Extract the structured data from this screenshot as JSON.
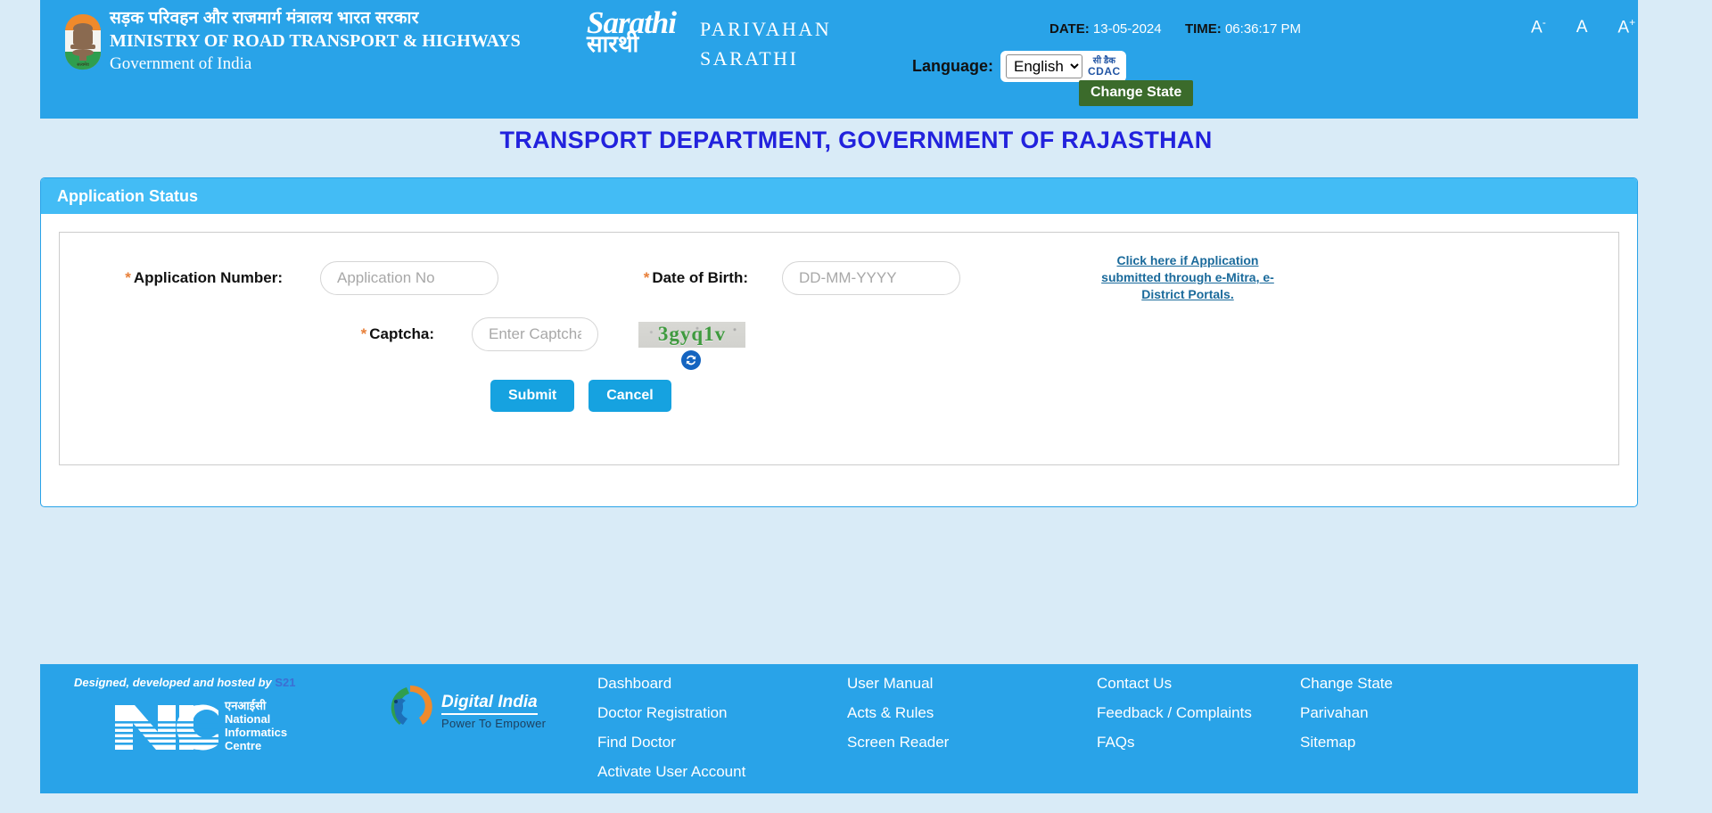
{
  "header": {
    "emblem_icon": "india-state-emblem",
    "ministry_hindi": "सड़क परिवहन और राजमार्ग मंत्रालय भारत सरकार",
    "ministry_english": "MINISTRY OF ROAD TRANSPORT & HIGHWAYS",
    "ministry_gov": "Government of India",
    "sarathi_logo_en": "Sarathi",
    "sarathi_logo_hi": "सारथी",
    "parivahan": "PARIVAHAN",
    "sarathi": "SARATHI",
    "date_label": "DATE:",
    "date_value": "13-05-2024",
    "time_label": "TIME:",
    "time_value": "06:36:17 PM",
    "language_label": "Language:",
    "language_selected": "English",
    "language_options": [
      "English"
    ],
    "cdac_hindi": "सी डैक",
    "cdac_english": "CDAC",
    "change_state": "Change State",
    "font_decrease": "A",
    "font_decrease_sup": "-",
    "font_normal": "A",
    "font_increase": "A",
    "font_increase_sup": "+"
  },
  "page_title": "TRANSPORT DEPARTMENT, GOVERNMENT OF RAJASTHAN",
  "panel": {
    "title": "Application Status",
    "application_number": {
      "label": "Application Number:",
      "required": "*",
      "value": "",
      "placeholder": "Application No"
    },
    "date_of_birth": {
      "label": "Date of Birth:",
      "required": "*",
      "value": "",
      "placeholder": "DD-MM-YYYY"
    },
    "emitra_link_line1": "Click here if Application submitted",
    "emitra_link_line2": "through e-Mitra, e-District Portals.",
    "captcha": {
      "label": "Captcha:",
      "required": "*",
      "value": "",
      "placeholder": "Enter Captcha Here",
      "image_text": "3gyq1v",
      "refresh_icon": "refresh-icon"
    },
    "submit_label": "Submit",
    "cancel_label": "Cancel"
  },
  "footer": {
    "designed_by": "Designed, developed and hosted by",
    "designed_by_suffix": "S21",
    "nic_hindi": "एनआईसी",
    "nic_line1": "National",
    "nic_line2": "Informatics",
    "nic_line3": "Centre",
    "digital_india_title": "Digital India",
    "digital_india_sub": "Power To Empower",
    "columns": [
      [
        "Dashboard",
        "Doctor Registration",
        "Find Doctor",
        "Activate User Account"
      ],
      [
        "User Manual",
        "Acts & Rules",
        "Screen Reader"
      ],
      [
        "Contact Us",
        "Feedback / Complaints",
        "FAQs"
      ],
      [
        "Change State",
        "Parivahan",
        "Sitemap"
      ]
    ]
  },
  "colors": {
    "header_blue": "#29a3e8",
    "panel_head_blue": "#43bcf5",
    "page_bg": "#d9ebf7",
    "title_blue": "#2222dd",
    "button_blue": "#16a2e0",
    "change_state_green": "#3b6b2b",
    "required_orange": "#e8803a",
    "link_blue": "#1a6a9b",
    "captcha_green": "#3f9a3f"
  }
}
